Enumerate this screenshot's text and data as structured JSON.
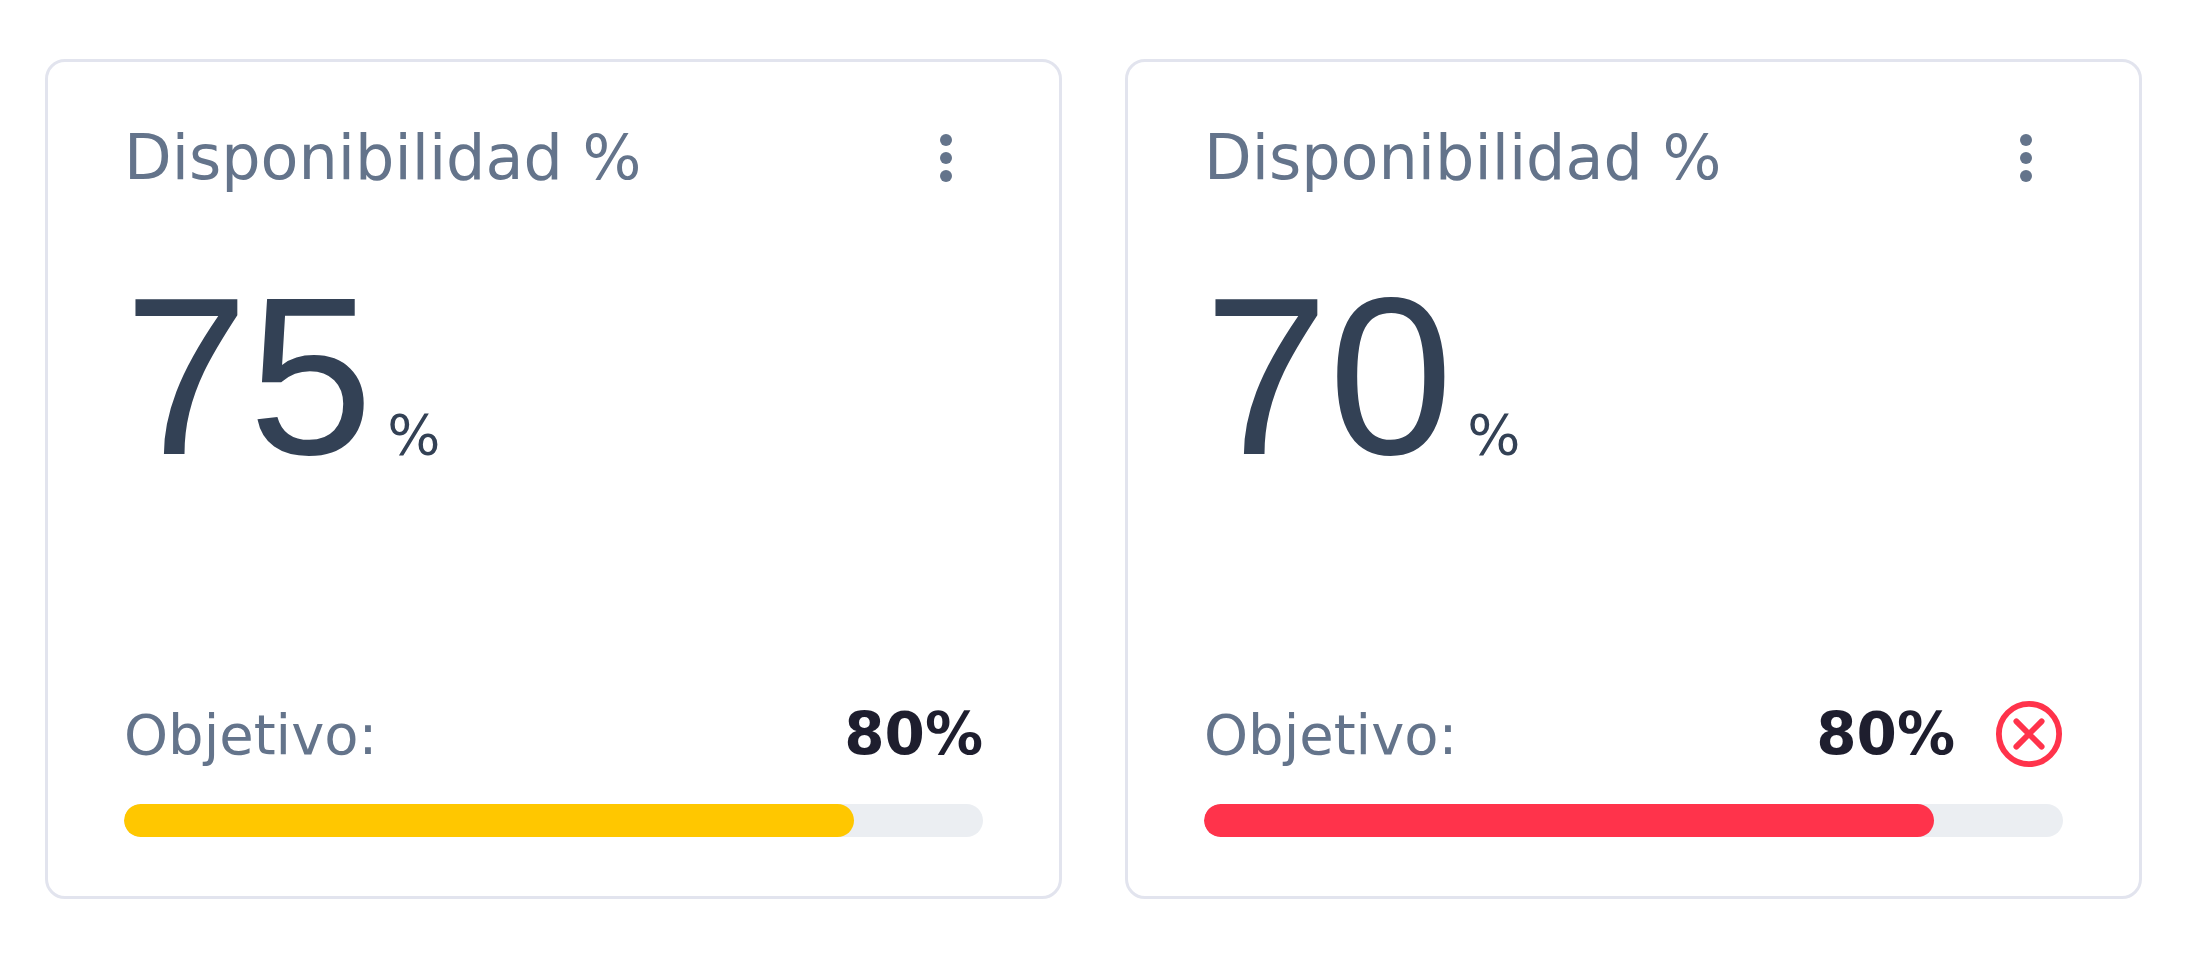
{
  "cards": [
    {
      "title": "Disponibilidad %",
      "value": "75",
      "unit": "%",
      "target_label": "Objetivo:",
      "target": "80%",
      "alert": false,
      "level": 0.85,
      "color": "#ffc700"
    },
    {
      "title": "Disponibilidad %",
      "value": "70",
      "unit": "%",
      "target_label": "Objetivo:",
      "target": "80%",
      "alert": true,
      "level": 0.85,
      "color": "#ff334b"
    }
  ]
}
